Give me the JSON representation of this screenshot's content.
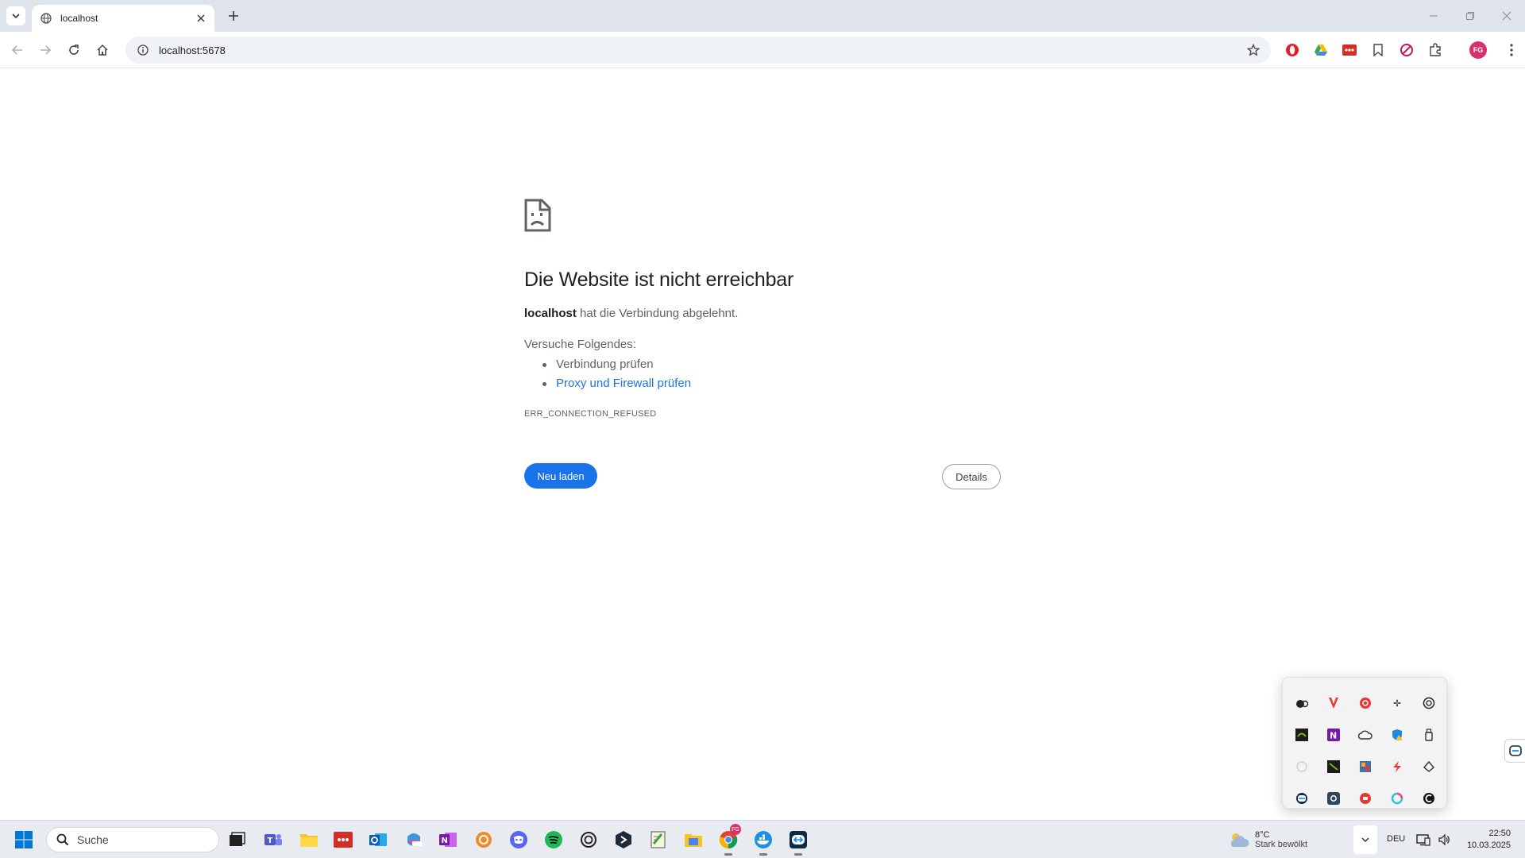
{
  "browser": {
    "tab": {
      "title": "localhost"
    },
    "omnibox": {
      "url": "localhost:5678"
    },
    "profile_initials": "FG"
  },
  "error_page": {
    "title": "Die Website ist nicht erreichbar",
    "host": "localhost",
    "description_rest": " hat die Verbindung abgelehnt.",
    "try_label": "Versuche Folgendes:",
    "suggestions": [
      "Verbindung prüfen",
      "Proxy und Firewall prüfen"
    ],
    "error_code": "ERR_CONNECTION_REFUSED",
    "reload_label": "Neu laden",
    "details_label": "Details"
  },
  "taskbar": {
    "search_label": "Suche",
    "weather": {
      "temp": "8°C",
      "condition": "Stark bewölkt"
    },
    "language": "DEU",
    "time": "22:50",
    "date": "10.03.2025",
    "chrome_badge": "FG"
  },
  "colors": {
    "accent": "#1a73e8",
    "tabstrip": "#dfe3eb",
    "taskbar": "#e8ecf1",
    "avatar": "#d6336c"
  }
}
